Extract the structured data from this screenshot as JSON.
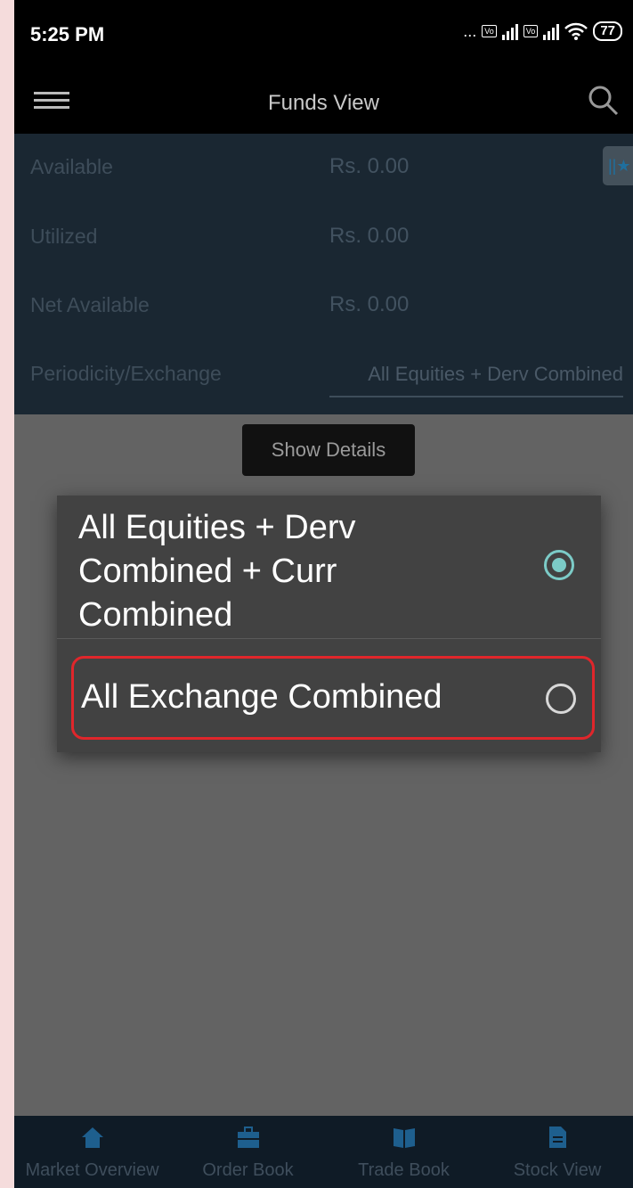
{
  "status_bar": {
    "time": "5:25 PM",
    "dots": "...",
    "volte1": "VoLTE",
    "volte2": "VoLTE",
    "battery": "77"
  },
  "app_bar": {
    "title": "Funds View"
  },
  "funds": {
    "available_label": "Available",
    "available_value": "Rs. 0.00",
    "utilized_label": "Utilized",
    "utilized_value": "Rs. 0.00",
    "net_available_label": "Net Available",
    "net_available_value": "Rs. 0.00",
    "periodicity_label": "Periodicity/Exchange",
    "periodicity_value": "All Equities + Derv Combined"
  },
  "show_details_label": "Show Details",
  "dialog": {
    "options": [
      {
        "label": "All Equities + Derv Combined + Curr Combined",
        "selected": true
      },
      {
        "label": "All Exchange Combined",
        "selected": false
      }
    ]
  },
  "bottom_nav": {
    "items": [
      {
        "label": "Market Overview",
        "icon": "home-icon"
      },
      {
        "label": "Order Book",
        "icon": "briefcase-icon"
      },
      {
        "label": "Trade Book",
        "icon": "book-icon"
      },
      {
        "label": "Stock View",
        "icon": "document-icon"
      }
    ]
  },
  "colors": {
    "accent": "#7ccbc7",
    "highlight": "#e0262b",
    "panel": "#1a2732"
  }
}
